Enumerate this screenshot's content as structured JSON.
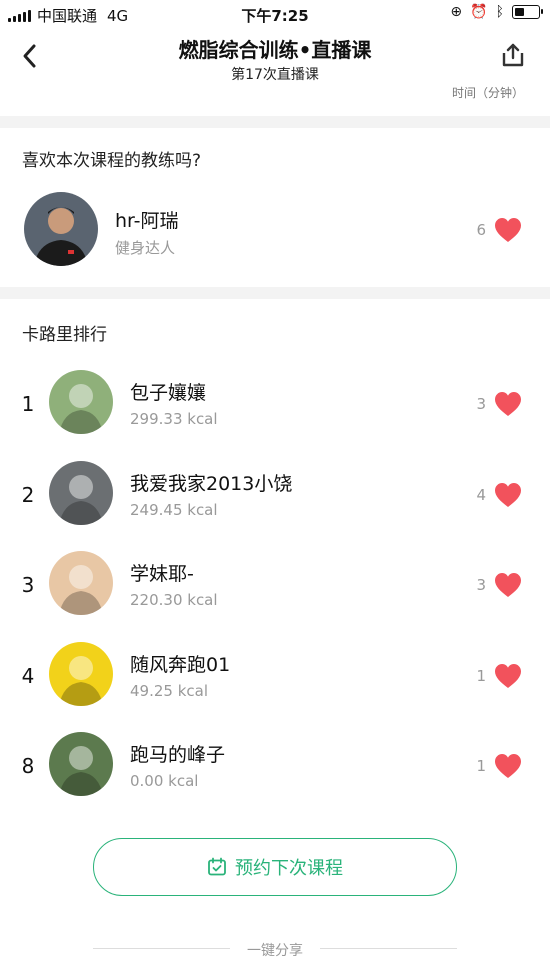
{
  "status_bar": {
    "carrier": "中国联通",
    "network": "4G",
    "time": "下午7:25",
    "battery_level": 0.4
  },
  "header": {
    "title": "燃脂综合训练•直播课",
    "subtitle": "第17次直播课",
    "time_label": "时间（分钟）"
  },
  "coach": {
    "section_title": "喜欢本次课程的教练吗?",
    "name": "hr-阿瑞",
    "tag": "健身达人",
    "likes": "6"
  },
  "ranking": {
    "section_title": "卡路里排行",
    "rows": [
      {
        "rank": "1",
        "name": "包子孃孃",
        "kcal": "299.33 kcal",
        "likes": "3",
        "avatar_color": "#8fb07a"
      },
      {
        "rank": "2",
        "name": "我爱我家2013小饶",
        "kcal": "249.45 kcal",
        "likes": "4",
        "avatar_color": "#6b6f72"
      },
      {
        "rank": "3",
        "name": "学妹耶-",
        "kcal": "220.30 kcal",
        "likes": "3",
        "avatar_color": "#e8c7a5"
      },
      {
        "rank": "4",
        "name": "随风奔跑01",
        "kcal": "49.25 kcal",
        "likes": "1",
        "avatar_color": "#f2d21a"
      },
      {
        "rank": "8",
        "name": "跑马的峰子",
        "kcal": "0.00 kcal",
        "likes": "1",
        "avatar_color": "#5c7a4e"
      }
    ]
  },
  "actions": {
    "reserve_label": "预约下次课程",
    "share_label": "一键分享"
  },
  "colors": {
    "accent_green": "#2ab37a",
    "heart_red": "#f2525c"
  },
  "icons": {
    "back": "chevron-left-icon",
    "share": "share-icon",
    "heart": "heart-icon",
    "calendar": "calendar-check-icon"
  }
}
